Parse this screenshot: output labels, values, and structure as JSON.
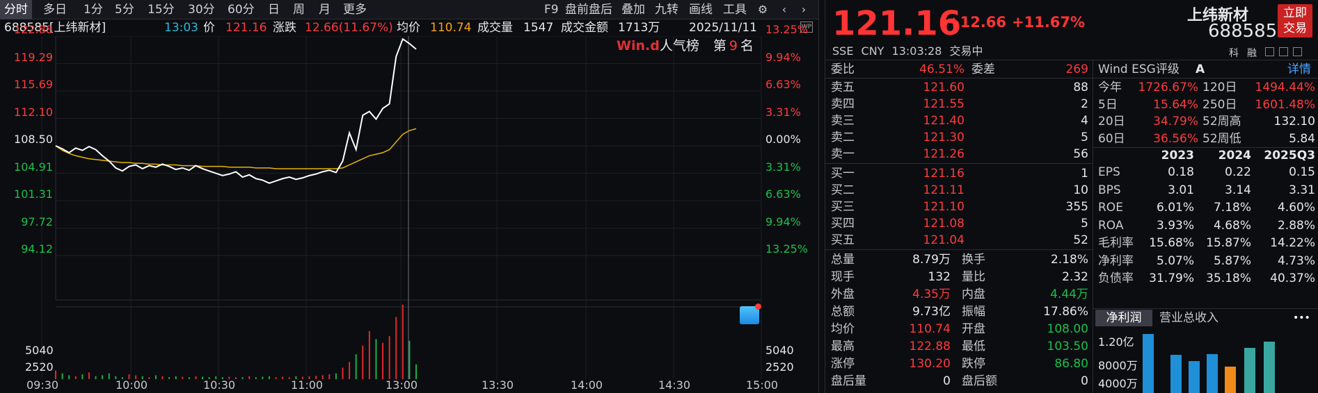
{
  "toolbar": {
    "tabs": [
      "分时",
      "多日",
      "1分",
      "5分",
      "15分",
      "30分",
      "60分",
      "日",
      "周",
      "月",
      "更多"
    ],
    "right": [
      "F9",
      "盘前盘后",
      "叠加",
      "九转",
      "画线",
      "工具"
    ]
  },
  "info": {
    "code_name": "688585[上纬新材]",
    "time": "13:03",
    "price_label": "价",
    "price": "121.16",
    "chg_label": "涨跌",
    "chg": "12.66(11.67%)",
    "avg_label": "均价",
    "avg": "110.74",
    "vol_label": "成交量",
    "vol": "1547",
    "amt_label": "成交金额",
    "amt": "1713万",
    "date": "2025/11/11"
  },
  "chart": {
    "wind_logo": "Win.d",
    "rank_label": "人气榜",
    "rank_pre": "第",
    "rank_num": "9",
    "rank_post": "名",
    "yticks_left": [
      "122.88",
      "119.29",
      "115.69",
      "112.10",
      "108.50",
      "104.91",
      "101.31",
      "97.72",
      "94.12"
    ],
    "yticks_right": [
      "13.25%",
      "9.94%",
      "6.63%",
      "3.31%",
      "0.00%",
      "3.31%",
      "6.63%",
      "9.94%",
      "13.25%"
    ],
    "vol_ticks": [
      "5040",
      "2520"
    ],
    "xticks": [
      "09:30",
      "10:00",
      "10:30",
      "11:00",
      "13:00",
      "13:30",
      "14:00",
      "14:30",
      "15:00"
    ]
  },
  "chart_data": {
    "type": "line",
    "title": "",
    "series": [],
    "x_range": [
      "09:30",
      "15:00"
    ],
    "y_range": [
      94.12,
      122.88
    ],
    "prev_close": 108.5,
    "price": [
      108.5,
      108.1,
      107.6,
      108.2,
      107.9,
      108.4,
      108.0,
      107.2,
      106.5,
      105.6,
      105.2,
      105.8,
      106.0,
      105.5,
      105.9,
      105.7,
      106.1,
      105.8,
      105.4,
      105.6,
      105.3,
      105.9,
      105.5,
      105.2,
      104.9,
      104.6,
      104.8,
      105.1,
      104.4,
      104.7,
      104.2,
      104.0,
      103.6,
      103.9,
      104.2,
      104.4,
      104.1,
      104.3,
      104.6,
      104.8,
      105.1,
      105.3,
      105.0,
      106.5,
      110.2,
      108.0,
      112.5,
      113.0,
      112.0,
      113.4,
      114.0,
      120.2,
      122.5,
      121.9,
      121.16
    ],
    "avg": [
      108.5,
      107.9,
      107.5,
      107.2,
      107.0,
      106.8,
      106.7,
      106.6,
      106.5,
      106.4,
      106.3,
      106.3,
      106.2,
      106.2,
      106.1,
      106.1,
      106.0,
      106.0,
      106.0,
      105.9,
      105.9,
      105.9,
      105.8,
      105.8,
      105.8,
      105.8,
      105.7,
      105.7,
      105.7,
      105.7,
      105.6,
      105.6,
      105.6,
      105.5,
      105.5,
      105.5,
      105.5,
      105.5,
      105.5,
      105.5,
      105.5,
      105.5,
      105.5,
      105.6,
      106.0,
      106.4,
      106.8,
      107.2,
      107.4,
      107.6,
      108.0,
      109.0,
      110.0,
      110.5,
      110.74
    ],
    "volume": [
      900,
      600,
      400,
      300,
      500,
      700,
      300,
      400,
      600,
      300,
      200,
      500,
      400,
      300,
      200,
      400,
      300,
      200,
      300,
      250,
      200,
      300,
      250,
      200,
      300,
      200,
      250,
      200,
      200,
      300,
      200,
      250,
      300,
      200,
      250,
      200,
      300,
      250,
      300,
      350,
      400,
      500,
      600,
      1200,
      1800,
      2600,
      3500,
      5040,
      4200,
      3800,
      4500,
      6500,
      7800,
      4000,
      1547
    ]
  },
  "quote": {
    "price": "121.16",
    "chg": "+12.66",
    "chgp": "+11.67%",
    "name": "上纬新材",
    "code": "688585",
    "trade_btn": "立即交易",
    "exchange": "SSE",
    "currency": "CNY",
    "time": "13:03:28",
    "status": "交易中"
  },
  "orderbook": {
    "weibi_label": "委比",
    "weibi": "46.51%",
    "weicha_label": "委差",
    "weicha": "269",
    "asks": [
      {
        "l": "卖五",
        "p": "121.60",
        "v": "88"
      },
      {
        "l": "卖四",
        "p": "121.55",
        "v": "2"
      },
      {
        "l": "卖三",
        "p": "121.40",
        "v": "4"
      },
      {
        "l": "卖二",
        "p": "121.30",
        "v": "5"
      },
      {
        "l": "卖一",
        "p": "121.26",
        "v": "56"
      }
    ],
    "bids": [
      {
        "l": "买一",
        "p": "121.16",
        "v": "1"
      },
      {
        "l": "买二",
        "p": "121.11",
        "v": "10"
      },
      {
        "l": "买三",
        "p": "121.10",
        "v": "355"
      },
      {
        "l": "买四",
        "p": "121.08",
        "v": "5"
      },
      {
        "l": "买五",
        "p": "121.04",
        "v": "52"
      }
    ]
  },
  "stats": [
    [
      "总量",
      "8.79万",
      "换手",
      "2.18%"
    ],
    [
      "现手",
      "132",
      "量比",
      "2.32"
    ],
    [
      "外盘",
      "4.35万",
      "内盘",
      "4.44万"
    ],
    [
      "总额",
      "9.73亿",
      "振幅",
      "17.86%"
    ],
    [
      "均价",
      "110.74",
      "开盘",
      "108.00"
    ],
    [
      "最高",
      "122.88",
      "最低",
      "103.50"
    ],
    [
      "涨停",
      "130.20",
      "跌停",
      "86.80"
    ],
    [
      "盘后量",
      "0",
      "盘后额",
      "0"
    ]
  ],
  "esg": {
    "label": "Wind ESG评级",
    "grade": "A",
    "detail": "详情",
    "side_icons": [
      "科",
      "融"
    ]
  },
  "perf": [
    [
      "今年",
      "1726.67%",
      "120日",
      "1494.44%"
    ],
    [
      "5日",
      "15.64%",
      "250日",
      "1601.48%"
    ],
    [
      "20日",
      "34.79%",
      "52周高",
      "132.10"
    ],
    [
      "60日",
      "36.56%",
      "52周低",
      "5.84"
    ]
  ],
  "fin": {
    "years": [
      "2023",
      "2024",
      "2025Q3"
    ],
    "rows": [
      [
        "EPS",
        "0.18",
        "0.22",
        "0.15"
      ],
      [
        "BPS",
        "3.01",
        "3.14",
        "3.31"
      ],
      [
        "ROE",
        "6.01%",
        "7.18%",
        "4.60%"
      ],
      [
        "ROA",
        "3.93%",
        "4.68%",
        "2.88%"
      ],
      [
        "毛利率",
        "15.68%",
        "15.87%",
        "14.22%"
      ],
      [
        "净利率",
        "5.07%",
        "5.87%",
        "4.73%"
      ],
      [
        "负债率",
        "31.79%",
        "35.18%",
        "40.37%"
      ]
    ]
  },
  "mini": {
    "tabs": [
      "净利润",
      "营业总收入"
    ],
    "more": "•••",
    "yticks": [
      "1.20亿",
      "8000万",
      "4000万"
    ],
    "bars": [
      {
        "v": 1.12,
        "c": "#1f8fd8"
      },
      {
        "v": 0.72,
        "c": "#1f8fd8"
      },
      {
        "v": 0.6,
        "c": "#1f8fd8"
      },
      {
        "v": 0.74,
        "c": "#1f8fd8"
      },
      {
        "v": 0.5,
        "c": "#f08a1a"
      },
      {
        "v": 0.85,
        "c": "#3aa6a0"
      },
      {
        "v": 0.98,
        "c": "#3aa6a0"
      }
    ]
  }
}
